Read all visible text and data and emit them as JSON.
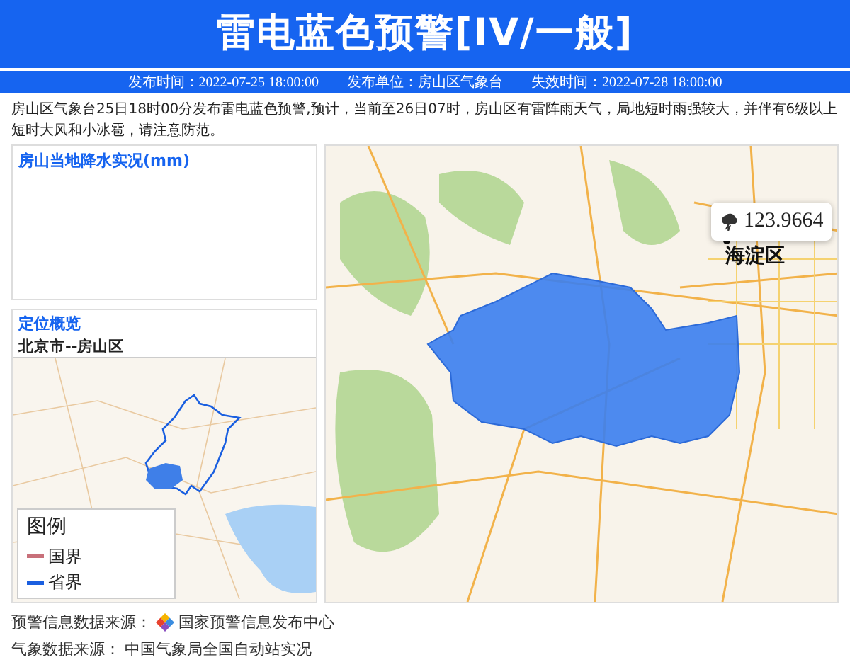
{
  "header": {
    "title": "雷电蓝色预警[IV/一般]"
  },
  "meta": [
    {
      "label": "发布时间：",
      "value": "2022-07-25 18:00:00"
    },
    {
      "label": "发布单位：",
      "value": "房山区气象台"
    },
    {
      "label": "失效时间：",
      "value": "2022-07-28 18:00:00"
    }
  ],
  "description": "房山区气象台25日18时00分发布雷电蓝色预警,预计，当前至26日07时，房山区有雷阵雨天气，局地短时雨强较大，并伴有6级以上短时大风和小冰雹，请注意防范。",
  "precipitation_panel": {
    "title": "房山当地降水实况(mm)"
  },
  "location_panel": {
    "title": "定位概览",
    "subtitle": "北京市--房山区",
    "legend": {
      "title": "图例",
      "items": [
        {
          "label": "国界",
          "color": "#c8707a"
        },
        {
          "label": "省界",
          "color": "#1a5fe0"
        }
      ]
    }
  },
  "main_map": {
    "tooltip": "123.9664",
    "place_label": "海淀区"
  },
  "sources": [
    {
      "label": "预警信息数据来源：",
      "value": "国家预警信息发布中心",
      "has_logo": true
    },
    {
      "label": "气象数据来源：",
      "value": "中国气象局全国自动站实况",
      "has_logo": false
    }
  ]
}
